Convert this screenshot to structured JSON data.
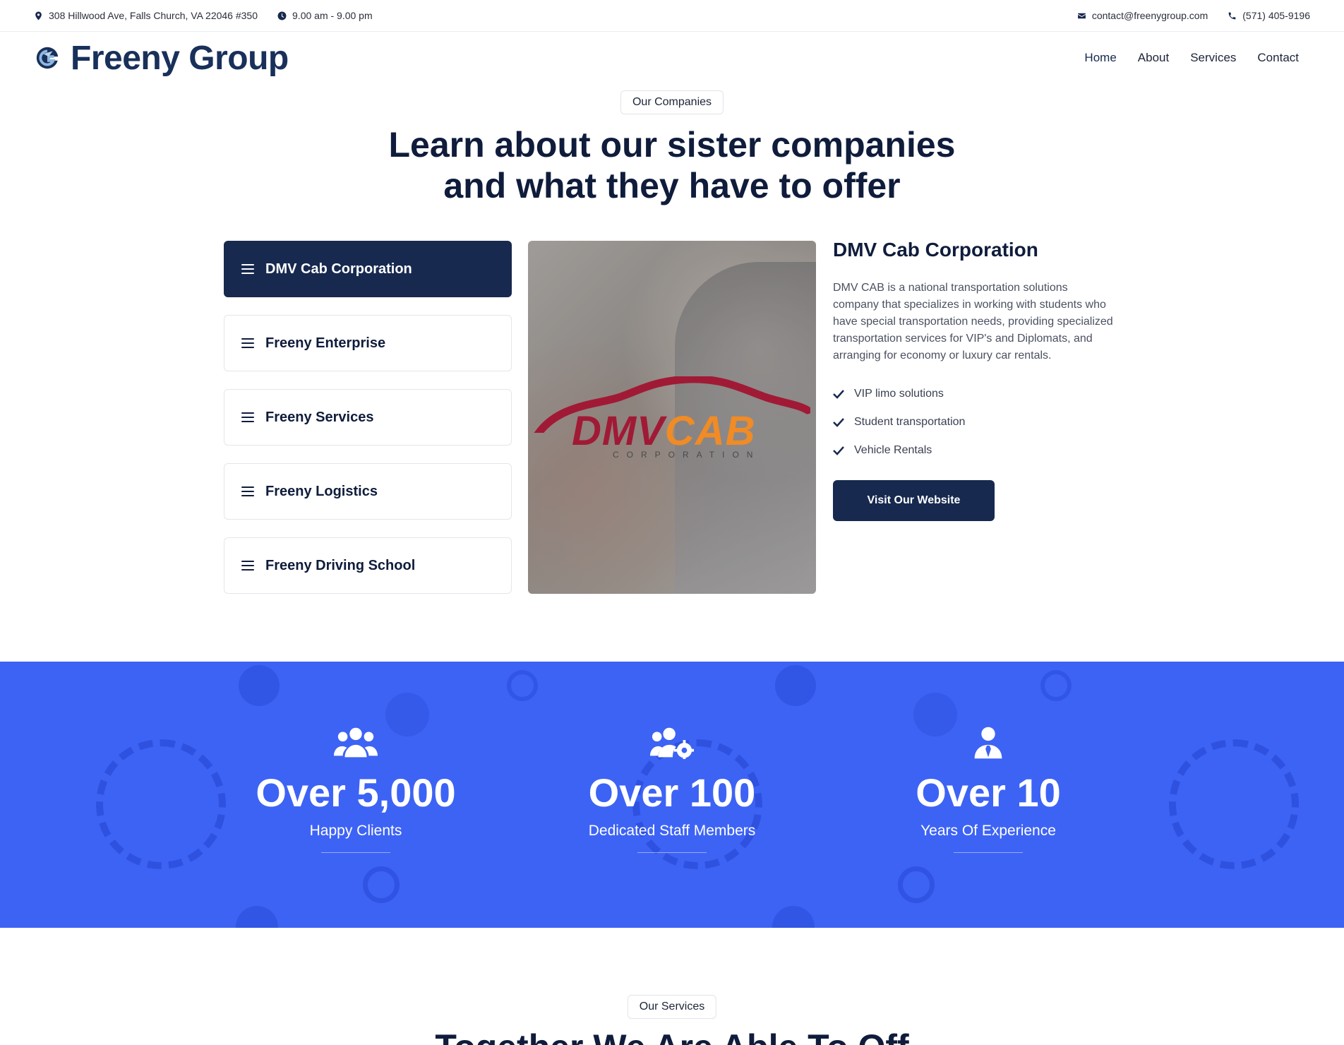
{
  "topbar": {
    "address": "308 Hillwood Ave, Falls Church, VA 22046 #350",
    "hours": "9.00 am - 9.00 pm",
    "email": "contact@freenygroup.com",
    "phone": "(571) 405-9196"
  },
  "brand": {
    "name": "Freeny Group"
  },
  "nav": {
    "items": [
      "Home",
      "About",
      "Services",
      "Contact"
    ],
    "active": "Home"
  },
  "companies": {
    "eyebrow": "Our Companies",
    "headline_line1": "Learn about our sister companies",
    "headline_line2": "and what they have to offer",
    "tabs": [
      "DMV Cab Corporation",
      "Freeny Enterprise",
      "Freeny Services",
      "Freeny Logistics",
      "Freeny Driving School"
    ],
    "active_tab": "DMV Cab Corporation",
    "image_logo": {
      "word1": "DMV",
      "word2": "CAB",
      "sub": "CORPORATION"
    },
    "detail": {
      "title": "DMV Cab Corporation",
      "description": "DMV CAB is a national transportation solutions company that specializes in working with students who have special transportation needs, providing specialized transportation services for VIP's and Diplomats, and arranging for economy or luxury car rentals.",
      "features": [
        "VIP limo solutions",
        "Student transportation",
        "Vehicle Rentals"
      ],
      "cta": "Visit Our Website"
    }
  },
  "stats": [
    {
      "icon": "users-icon",
      "value": "Over 5,000",
      "label": "Happy Clients"
    },
    {
      "icon": "users-cog-icon",
      "value": "Over 100",
      "label": "Dedicated Staff Members"
    },
    {
      "icon": "user-tie-icon",
      "value": "Over 10",
      "label": "Years Of Experience"
    }
  ],
  "services": {
    "eyebrow": "Our Services",
    "headline_partial": "Together We Are Able To Off"
  },
  "colors": {
    "navy": "#17294f",
    "brand_text": "#18305a",
    "stats_blue": "#3d63f5",
    "dmv_red": "#a11a35",
    "cab_orange": "#f08b25"
  }
}
